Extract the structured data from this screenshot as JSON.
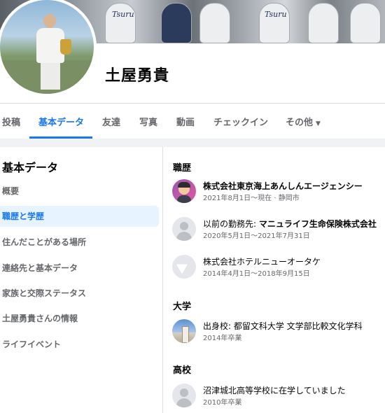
{
  "profile": {
    "name": "土屋勇貴"
  },
  "tabs": [
    {
      "label": "投稿"
    },
    {
      "label": "基本データ"
    },
    {
      "label": "友達"
    },
    {
      "label": "写真"
    },
    {
      "label": "動画"
    },
    {
      "label": "チェックイン"
    },
    {
      "label": "その他",
      "caret": "▼"
    }
  ],
  "sidebar": {
    "title": "基本データ",
    "items": [
      {
        "label": "概要"
      },
      {
        "label": "職歴と学歴"
      },
      {
        "label": "住んだことがある場所"
      },
      {
        "label": "連絡先と基本データ"
      },
      {
        "label": "家族と交際ステータス"
      },
      {
        "label": "土屋勇貴さんの情報"
      },
      {
        "label": "ライフイベント"
      }
    ]
  },
  "work": {
    "title": "職歴",
    "entries": [
      {
        "name": "株式会社東京海上あんしんエージェンシー",
        "detail": "2021年8月1日〜現在 · 静岡市",
        "icon": "bitmoji-avatar-icon"
      },
      {
        "prefix": "以前の勤務先: ",
        "name": "マニュライフ生命保険株式会社",
        "detail": "2020年5月1日〜2021年7月31日",
        "icon": "person-placeholder-icon"
      },
      {
        "name": "株式会社ホテルニューオータケ",
        "detail": "2014年4月1日〜2018年9月15日",
        "icon": "flag-icon"
      }
    ]
  },
  "college": {
    "title": "大学",
    "entries": [
      {
        "name": "出身校: 都留文科大学 文学部比較文化学科",
        "detail": "2014年卒業",
        "icon": "school-photo-icon"
      }
    ]
  },
  "highschool": {
    "title": "高校",
    "entries": [
      {
        "name": "沼津城北高等学校に在学していました",
        "detail": "2010年卒業",
        "icon": "person-placeholder-icon"
      }
    ]
  },
  "cover": {
    "jersey_text": "Tsuru"
  }
}
